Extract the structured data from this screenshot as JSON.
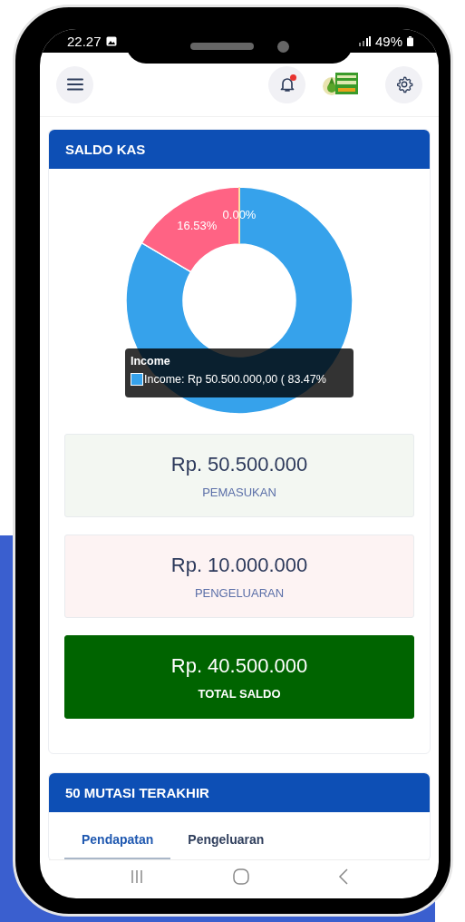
{
  "status_bar": {
    "time": "22.27",
    "battery": "49%"
  },
  "header": {
    "notification_unread": true
  },
  "saldo_card": {
    "title": "SALDO KAS",
    "chart_data": {
      "type": "donut",
      "values": [
        83.47,
        16.53,
        0
      ],
      "value_labels": [
        null,
        "16.53%",
        "0.00%"
      ],
      "colors": [
        "#36a2eb",
        "#ff6384",
        "#ffce56"
      ]
    },
    "tooltip": {
      "title": "Income",
      "text": "Income: Rp 50.500.000,00 ( 83.47%",
      "color": "#36a2eb"
    },
    "summaries": [
      {
        "kind": "income",
        "amount": "Rp. 50.500.000",
        "label": "PEMASUKAN"
      },
      {
        "kind": "expense",
        "amount": "Rp. 10.000.000",
        "label": "PENGELUARAN"
      },
      {
        "kind": "total",
        "amount": "Rp. 40.500.000",
        "label": "TOTAL SALDO"
      }
    ]
  },
  "mutasi_card": {
    "title": "50 MUTASI TERAKHIR",
    "tabs": [
      {
        "label": "Pendapatan",
        "selected": true
      },
      {
        "label": "Pengeluaran",
        "selected": false
      }
    ]
  }
}
